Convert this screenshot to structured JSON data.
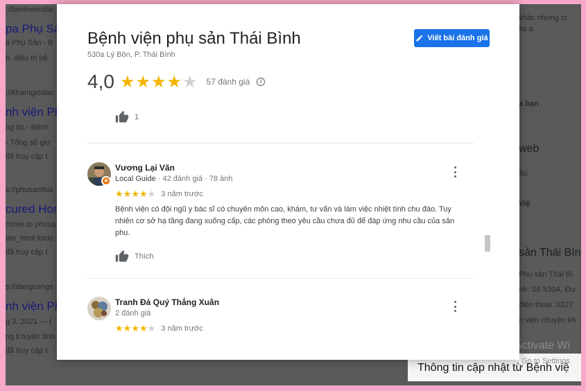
{
  "background": {
    "left_lines": [
      {
        "text": "://benhviendai",
        "kind": "url"
      },
      {
        "text": "pa Phụ Sả",
        "kind": "title"
      },
      {
        "text": "a Phụ Sản - B",
        "kind": "text"
      },
      {
        "text": "h, điều trị bệ",
        "kind": "text"
      },
      {
        "text": "://khamgiodau",
        "kind": "url"
      },
      {
        "text": "nh viện Ph",
        "kind": "title"
      },
      {
        "text": "ng tin.- Bệnh",
        "kind": "text"
      },
      {
        "text": "- Tổng số giư",
        "kind": "text"
      },
      {
        "text": "đã truy cập t",
        "kind": "text"
      },
      {
        "text": "s://phusanthai",
        "kind": "url"
      },
      {
        "text": "cured Hon",
        "kind": "title"
      },
      {
        "text": "come to phusa",
        "kind": "text"
      },
      {
        "text": "ate_html folde",
        "kind": "text"
      },
      {
        "text": "đã truy cập t",
        "kind": "text"
      },
      {
        "text": "s://dangcongs",
        "kind": "url"
      },
      {
        "text": "nh viện Ph",
        "kind": "title"
      },
      {
        "text": "g 3, 2021 — (",
        "kind": "text"
      },
      {
        "text": "ng ll tuyến tỉnh",
        "kind": "text"
      },
      {
        "text": "đã truy cập t",
        "kind": "text"
      }
    ],
    "right_lines": [
      {
        "text": "khác nhưng cr",
        "kind": "text"
      },
      {
        "text": "ko ạ.",
        "kind": "text"
      },
      {
        "text": "a bạn",
        "kind": "bold"
      },
      {
        "text": "web",
        "kind": "big"
      },
      {
        "text": "ầu",
        "kind": "text"
      },
      {
        "text": "Việ",
        "kind": "bold"
      },
      {
        "text": "sản Thái Bìn",
        "kind": "big"
      },
      {
        "text": "Phụ sản Thái Bì",
        "kind": "text"
      },
      {
        "text": "nh: Số 530A, Đư",
        "kind": "text"
      },
      {
        "text": "điện thoại: 0227",
        "kind": "text"
      },
      {
        "text": "n viện chuyên kh",
        "kind": "text"
      }
    ],
    "activate_title": "Activate Wi",
    "activate_sub": "Go to Settings",
    "bottom_bar_text": "Thông tin cập nhật từ Bệnh việ"
  },
  "dialog": {
    "title": "Bệnh viện phụ sản Thái Bình",
    "address": "530a Lý Bôn, P. Thái Bình",
    "write_review_label": "Viết bài đánh giá",
    "rating_value": "4,0",
    "rating_stars": 4,
    "rating_count": "57 đánh giá",
    "top_like_count": "1",
    "reviews": [
      {
        "name": "Vương Lại Văn",
        "guide_label": "Local Guide",
        "meta": " · 42 đánh giá · 78 ảnh",
        "stars": 4,
        "when": "3 năm trước",
        "text": "Bệnh viện có đội ngũ y bác sĩ có chuyên môn cao, khám, tư vấn và làm việc nhiệt tình chu đáo. Tuy nhiên cơ sở hạ tầng đang xuống cấp, các phòng theo yêu cầu chưa đủ để đáp ứng nhu cầu của sản phụ.",
        "like_label": "Thích"
      },
      {
        "name": "Tranh Đá Quý Thắng Xuân",
        "guide_label": "",
        "meta": "2 đánh giá",
        "stars": 4,
        "when": "3 năm trước"
      }
    ]
  },
  "colors": {
    "accent": "#1a73e8",
    "star": "#f4b400",
    "frame": "#f7a8c8"
  }
}
